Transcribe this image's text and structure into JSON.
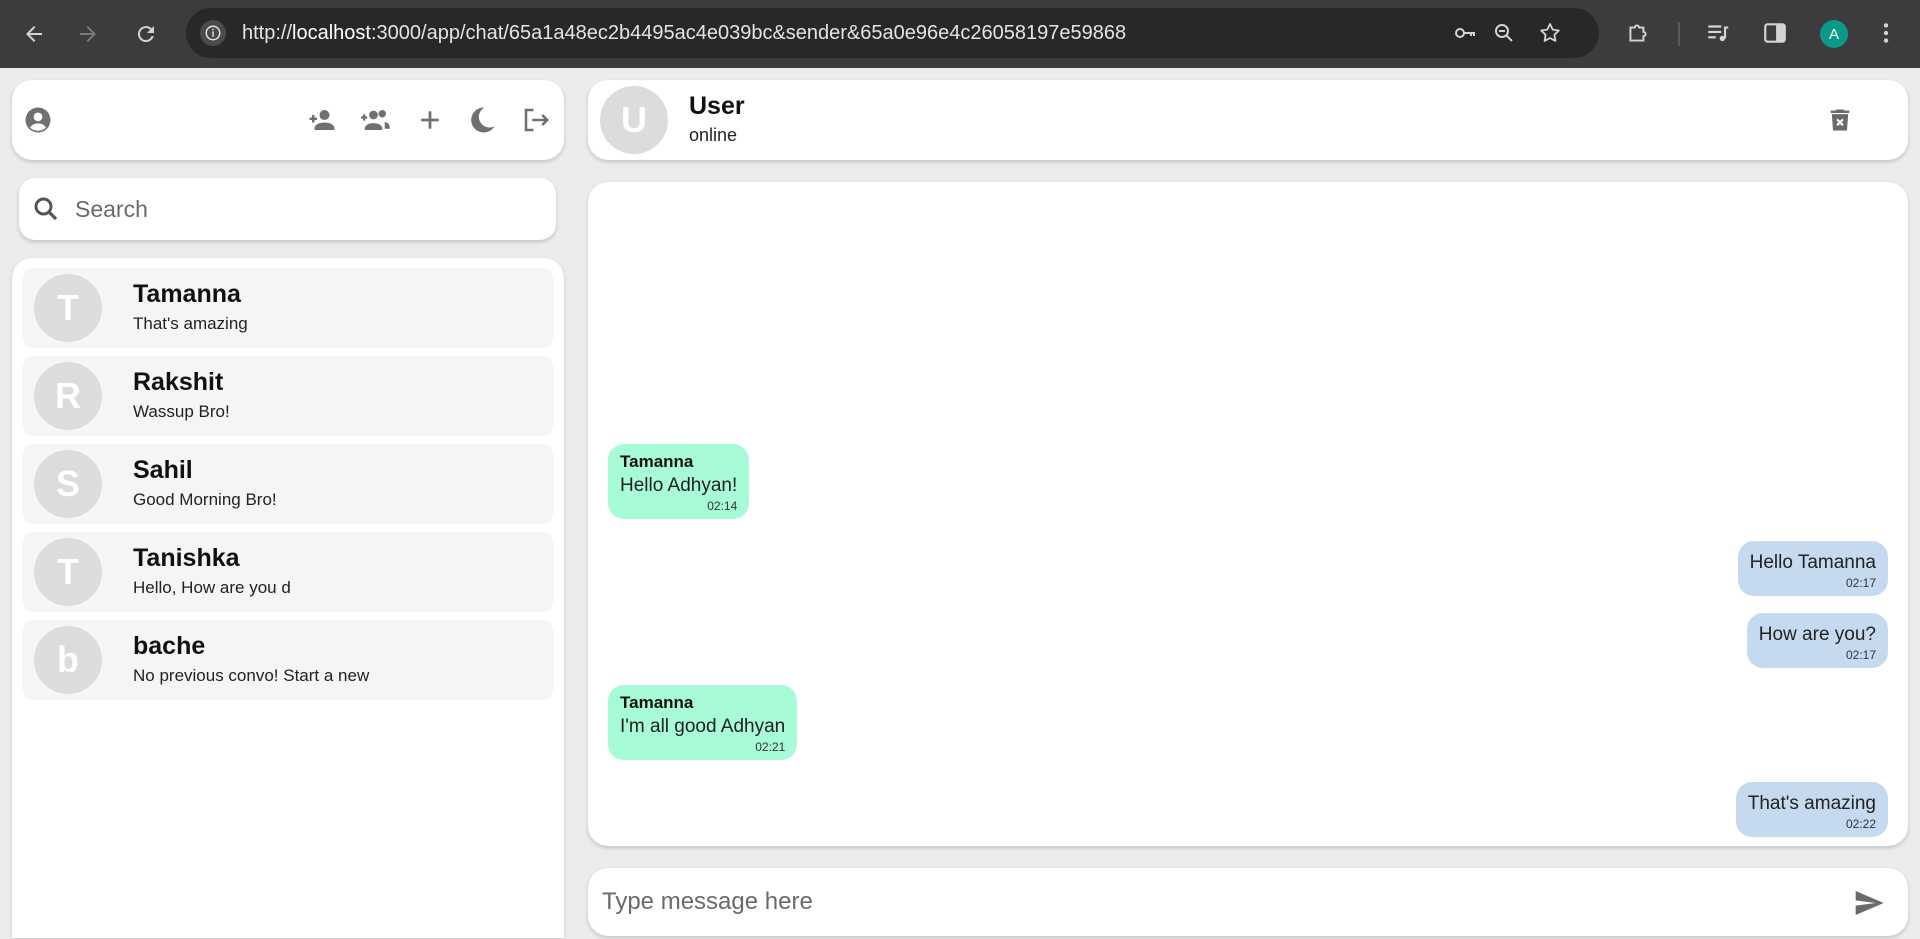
{
  "browser": {
    "url_prefix": "http://",
    "url_host": "localhost",
    "url_rest": ":3000/app/chat/65a1a48ec2b4495ac4e039bc&sender&65a0e96e4c26058197e59868",
    "profile_initial": "A",
    "accent_color": "#0b9a8a"
  },
  "sidebar": {
    "search_placeholder": "Search",
    "icons": [
      "account-circle-icon",
      "add-person-icon",
      "add-group-icon",
      "plus-icon",
      "moon-icon",
      "logout-icon"
    ],
    "chats": [
      {
        "initial": "T",
        "name": "Tamanna",
        "last_message": "That's amazing"
      },
      {
        "initial": "R",
        "name": "Rakshit",
        "last_message": "Wassup Bro!"
      },
      {
        "initial": "S",
        "name": "Sahil",
        "last_message": "Good Morning Bro!"
      },
      {
        "initial": "T",
        "name": "Tanishka",
        "last_message": "Hello, How are you d"
      },
      {
        "initial": "b",
        "name": "bache",
        "last_message": "No previous convo! Start a new"
      }
    ]
  },
  "conversation": {
    "avatar_initial": "U",
    "title": "User",
    "status": "online",
    "messages": [
      {
        "direction": "in",
        "sender": "Tamanna",
        "text": "Hello Adhyan!",
        "time": "02:14"
      },
      {
        "direction": "out",
        "text": "Hello Tamanna",
        "time": "02:17"
      },
      {
        "direction": "out",
        "text": "How are you?",
        "time": "02:17"
      },
      {
        "direction": "in",
        "sender": "Tamanna",
        "text": "I'm all good Adhyan",
        "time": "02:21"
      },
      {
        "direction": "out",
        "text": "That's amazing",
        "time": "02:22"
      }
    ],
    "input_placeholder": "Type message here"
  },
  "colors": {
    "incoming_bubble": "#a7fbd6",
    "outgoing_bubble": "#c5daee",
    "avatar_bg": "#dcdcdc",
    "app_bg": "#ececec"
  }
}
